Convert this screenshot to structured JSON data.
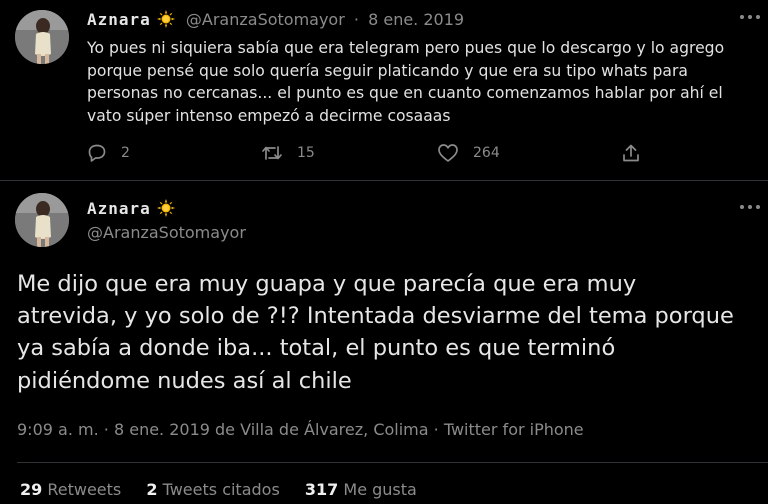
{
  "tweet1": {
    "display_name": "Aznara",
    "badge_icon": "sun-emoji-icon",
    "handle": "@AranzaSotomayor",
    "separator": "·",
    "date": "8 ene. 2019",
    "text": "Yo pues ni siquiera sabía que era telegram pero pues que lo descargo y lo agrego porque pensé que solo quería seguir platicando y que era su tipo whats para personas no cercanas... el punto es que en cuanto comenzamos hablar por ahí el vato súper intenso empezó a decirme cosaaas",
    "replies": "2",
    "retweets": "15",
    "likes": "264"
  },
  "tweet2": {
    "display_name": "Aznara",
    "badge_icon": "sun-emoji-icon",
    "handle": "@AranzaSotomayor",
    "text": "Me dijo que era muy guapa y que parecía que era muy atrevida, y yo solo de ?!? Intentada desviarme del tema porque ya sabía a donde iba... total, el punto es que terminó pidiéndome nudes así al chile",
    "time": "9:09 a. m.",
    "date": "8 ene. 2019 de Villa de Álvarez, Colima",
    "separator": "·",
    "source": "Twitter for iPhone",
    "retweets_count": "29",
    "retweets_label": "Retweets",
    "quotes_count": "2",
    "quotes_label": "Tweets citados",
    "likes_count": "317",
    "likes_label": "Me gusta"
  },
  "colors": {
    "background": "#000000",
    "text": "#e6e6e6",
    "muted": "#8b8b8b",
    "divider": "#2f3336"
  }
}
